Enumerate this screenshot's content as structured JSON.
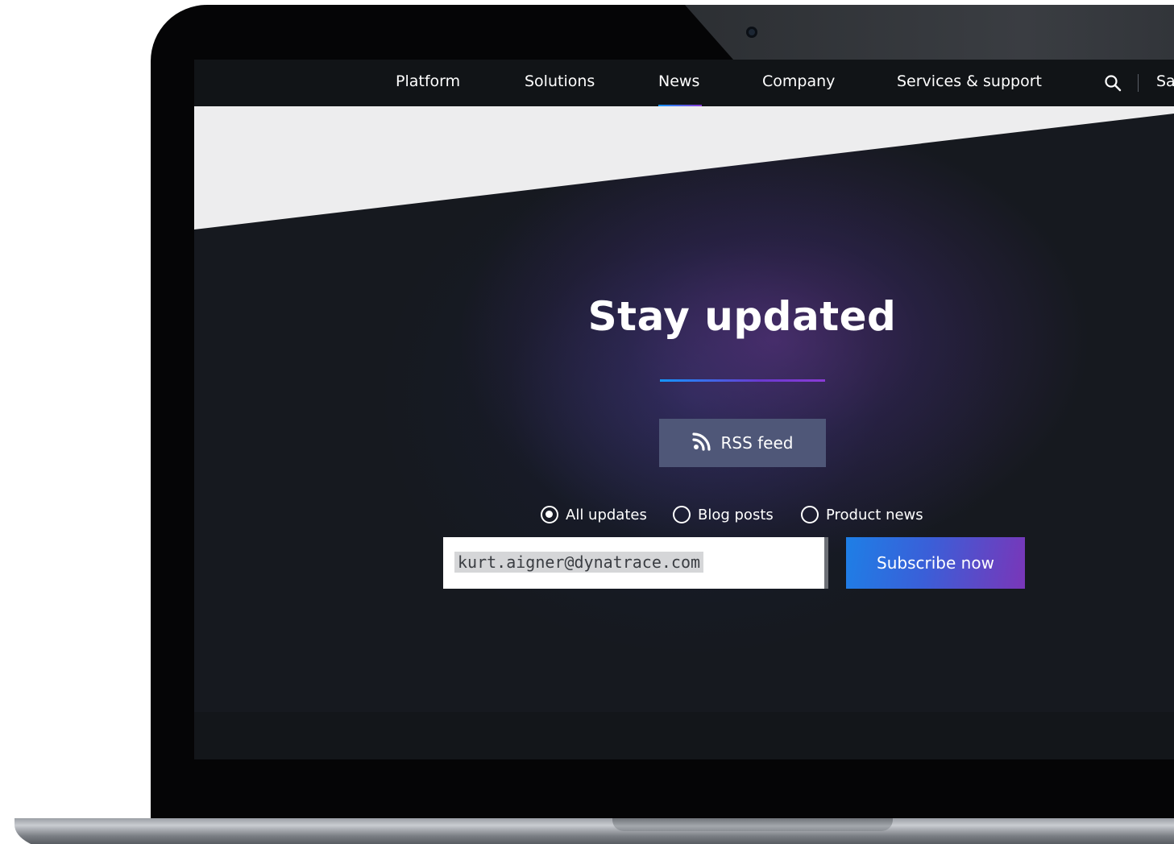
{
  "nav": {
    "items": [
      {
        "label": "Platform"
      },
      {
        "label": "Solutions"
      },
      {
        "label": "News",
        "active": true
      },
      {
        "label": "Company"
      },
      {
        "label": "Services & support"
      },
      {
        "label": "Sa"
      }
    ],
    "search_icon": "search-icon"
  },
  "hero": {
    "title": "Stay updated",
    "rss_button": {
      "label": "RSS feed",
      "icon": "rss-icon"
    },
    "filters": [
      {
        "label": "All updates",
        "checked": true
      },
      {
        "label": "Blog posts",
        "checked": false
      },
      {
        "label": "Product news",
        "checked": false
      }
    ],
    "email": {
      "value": "kurt.aigner@dynatrace.com"
    },
    "subscribe_label": "Subscribe now"
  },
  "colors": {
    "accent_blue": "#1496ff",
    "accent_purple": "#8a3bd6",
    "nav_bg": "#111417",
    "rss_button_bg": "#4f5778",
    "band_bg": "#ededee"
  }
}
